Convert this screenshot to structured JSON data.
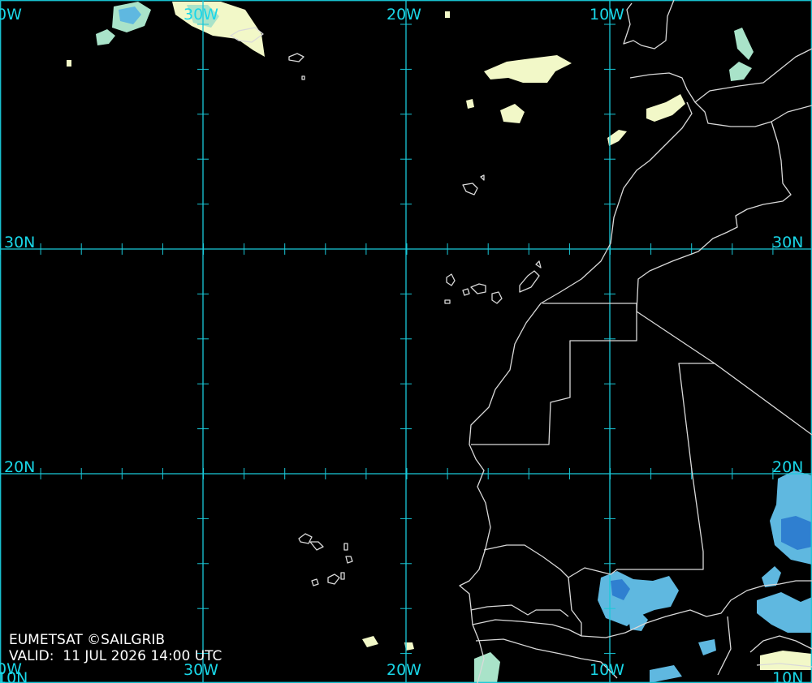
{
  "credit": "EUMETSAT ©SAILGRIB",
  "valid": "VALID:  11 JUL 2026 14:00 UTC",
  "longitude_labels": [
    "30W",
    "20W",
    "10W"
  ],
  "edge_labels": {
    "left_top": "0W",
    "left_bottom": "0W"
  },
  "latitude_labels": [
    "30N",
    "20N"
  ],
  "bottom_corner_labels": {
    "left": "10N",
    "right": "10N"
  },
  "colors": {
    "grid": "#19c9d9",
    "label": "#19d7e8",
    "coast": "#d9d9d9",
    "background": "#000000"
  }
}
